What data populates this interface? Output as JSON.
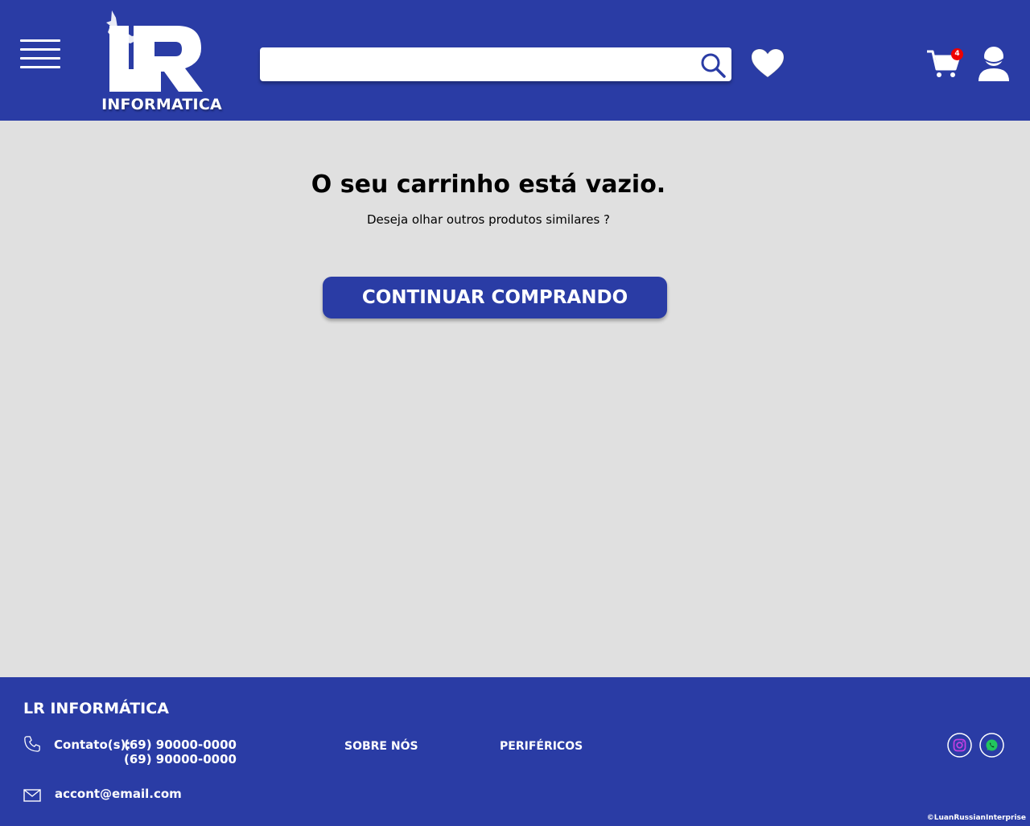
{
  "header": {
    "logo_text": "INFORMATICA",
    "logo_letters": "LR",
    "search": {
      "value": "",
      "placeholder": ""
    },
    "cart_count": "4"
  },
  "main": {
    "title": "O seu carrinho está vazio.",
    "subtitle": "Deseja olhar outros produtos similares ?",
    "continue_label": "CONTINUAR COMPRANDO"
  },
  "footer": {
    "brand": "LR INFORMÁTICA",
    "contact_label": "Contato(s):",
    "phones": [
      "(69) 90000-0000",
      "(69) 90000-0000"
    ],
    "email": "accont@email.com",
    "links": [
      "SOBRE NÓS",
      "PERIFÉRICOS"
    ],
    "copyright": "©LuanRussianInterprise"
  },
  "icons": {
    "menu": "hamburger-menu-icon",
    "search": "search-icon",
    "favorites": "heart-icon",
    "cart": "cart-icon",
    "account": "user-icon",
    "phone": "phone-icon",
    "mail": "mail-icon",
    "instagram": "instagram-icon",
    "whatsapp": "whatsapp-icon"
  },
  "colors": {
    "primary": "#2a3ca5",
    "background": "#e0e0e0",
    "badge": "#ee0000",
    "instagram": "#c13fe0",
    "whatsapp": "#22c55e"
  }
}
